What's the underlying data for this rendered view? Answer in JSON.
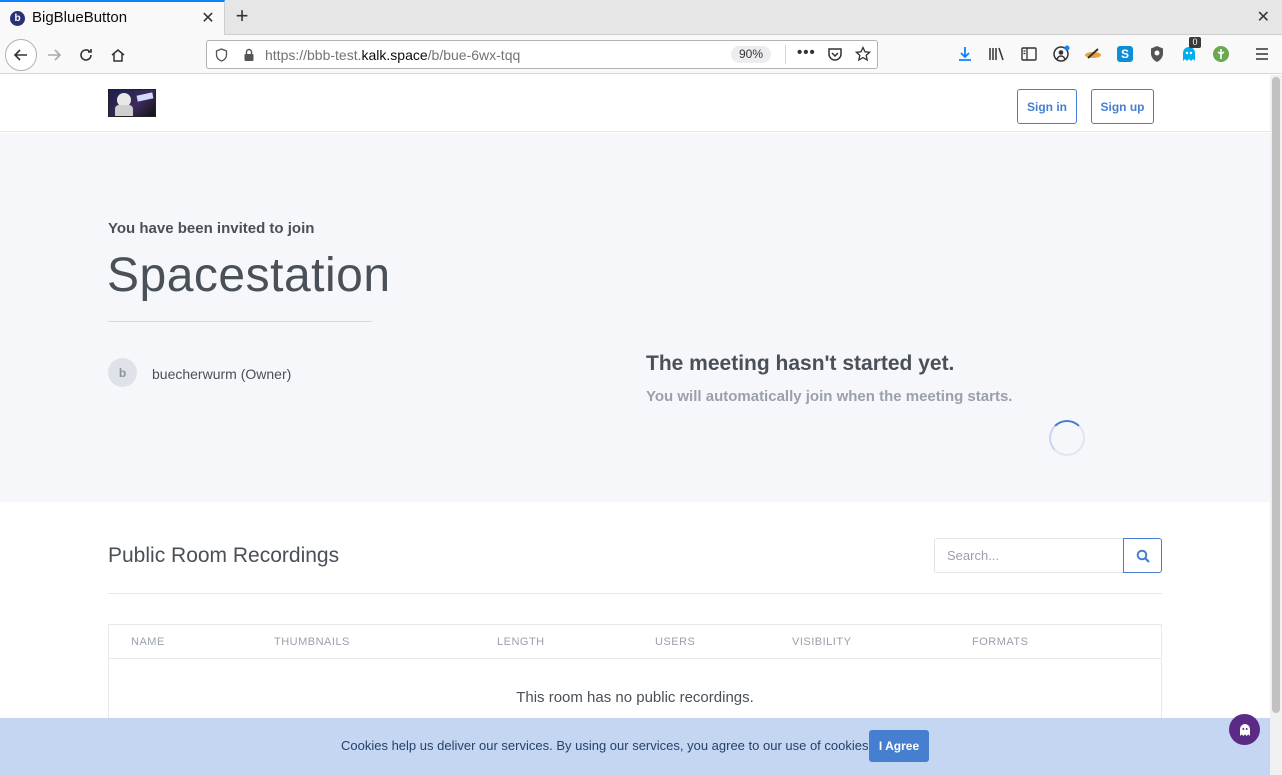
{
  "browser": {
    "tab_title": "BigBlueButton",
    "favicon_letter": "b",
    "url_prefix": "https://bbb-test.",
    "url_host": "kalk.space",
    "url_path": "/b/bue-6wx-tqq",
    "zoom": "90%",
    "extension_badge": "0"
  },
  "header": {
    "signin_label": "Sign in",
    "signup_label": "Sign up"
  },
  "room": {
    "invite_text": "You have been invited to join",
    "name": "Spacestation",
    "owner_initial": "b",
    "owner_name": "buecherwurm (Owner)",
    "wait_title": "The meeting hasn't started yet.",
    "wait_subtitle": "You will automatically join when the meeting starts."
  },
  "recordings": {
    "title": "Public Room Recordings",
    "search_placeholder": "Search...",
    "columns": [
      "NAME",
      "THUMBNAILS",
      "LENGTH",
      "USERS",
      "VISIBILITY",
      "FORMATS"
    ],
    "empty_message": "This room has no public recordings."
  },
  "cookie": {
    "text": "Cookies help us deliver our services. By using our services, you agree to our use of cookies.",
    "agree_label": "I Agree"
  },
  "colors": {
    "accent": "#467fcf",
    "hero_bg": "#f5f7fb",
    "cookie_bg": "#c5d6f3",
    "ghost": "#5b2a86"
  }
}
